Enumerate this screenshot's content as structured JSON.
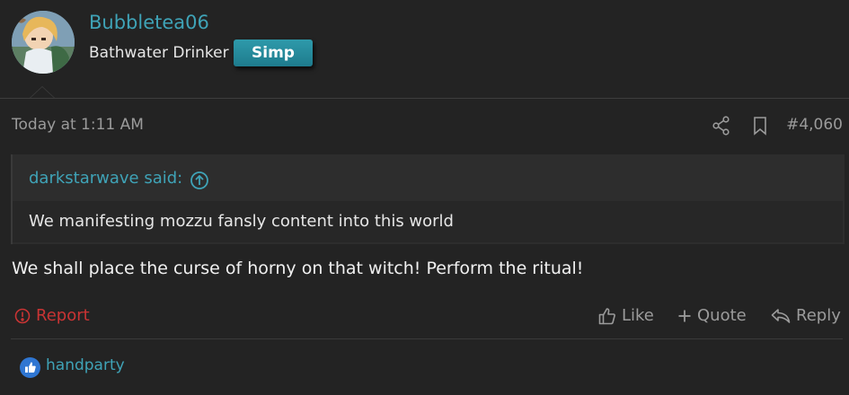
{
  "user": {
    "name": "Bubbletea06",
    "title": "Bathwater Drinker",
    "banner": "Simp"
  },
  "meta": {
    "timestamp": "Today at 1:11 AM",
    "post_number": "#4,060",
    "icons": [
      "share-icon",
      "bookmark-icon"
    ]
  },
  "quote": {
    "author_line": "darkstarwave said:",
    "text": "We manifesting mozzu fansly content into this world"
  },
  "message": "We shall place the curse of horny on that witch! Perform the ritual!",
  "actions": {
    "report": "Report",
    "like": "Like",
    "quote": "Quote",
    "reply": "Reply"
  },
  "reactions": {
    "users": "handparty",
    "icon": "thumbs-up-icon"
  },
  "colors": {
    "background": "#232323",
    "link": "#3fa3b7",
    "report": "#c93434",
    "banner": "#2590a3",
    "reaction": "#2f76d2"
  }
}
